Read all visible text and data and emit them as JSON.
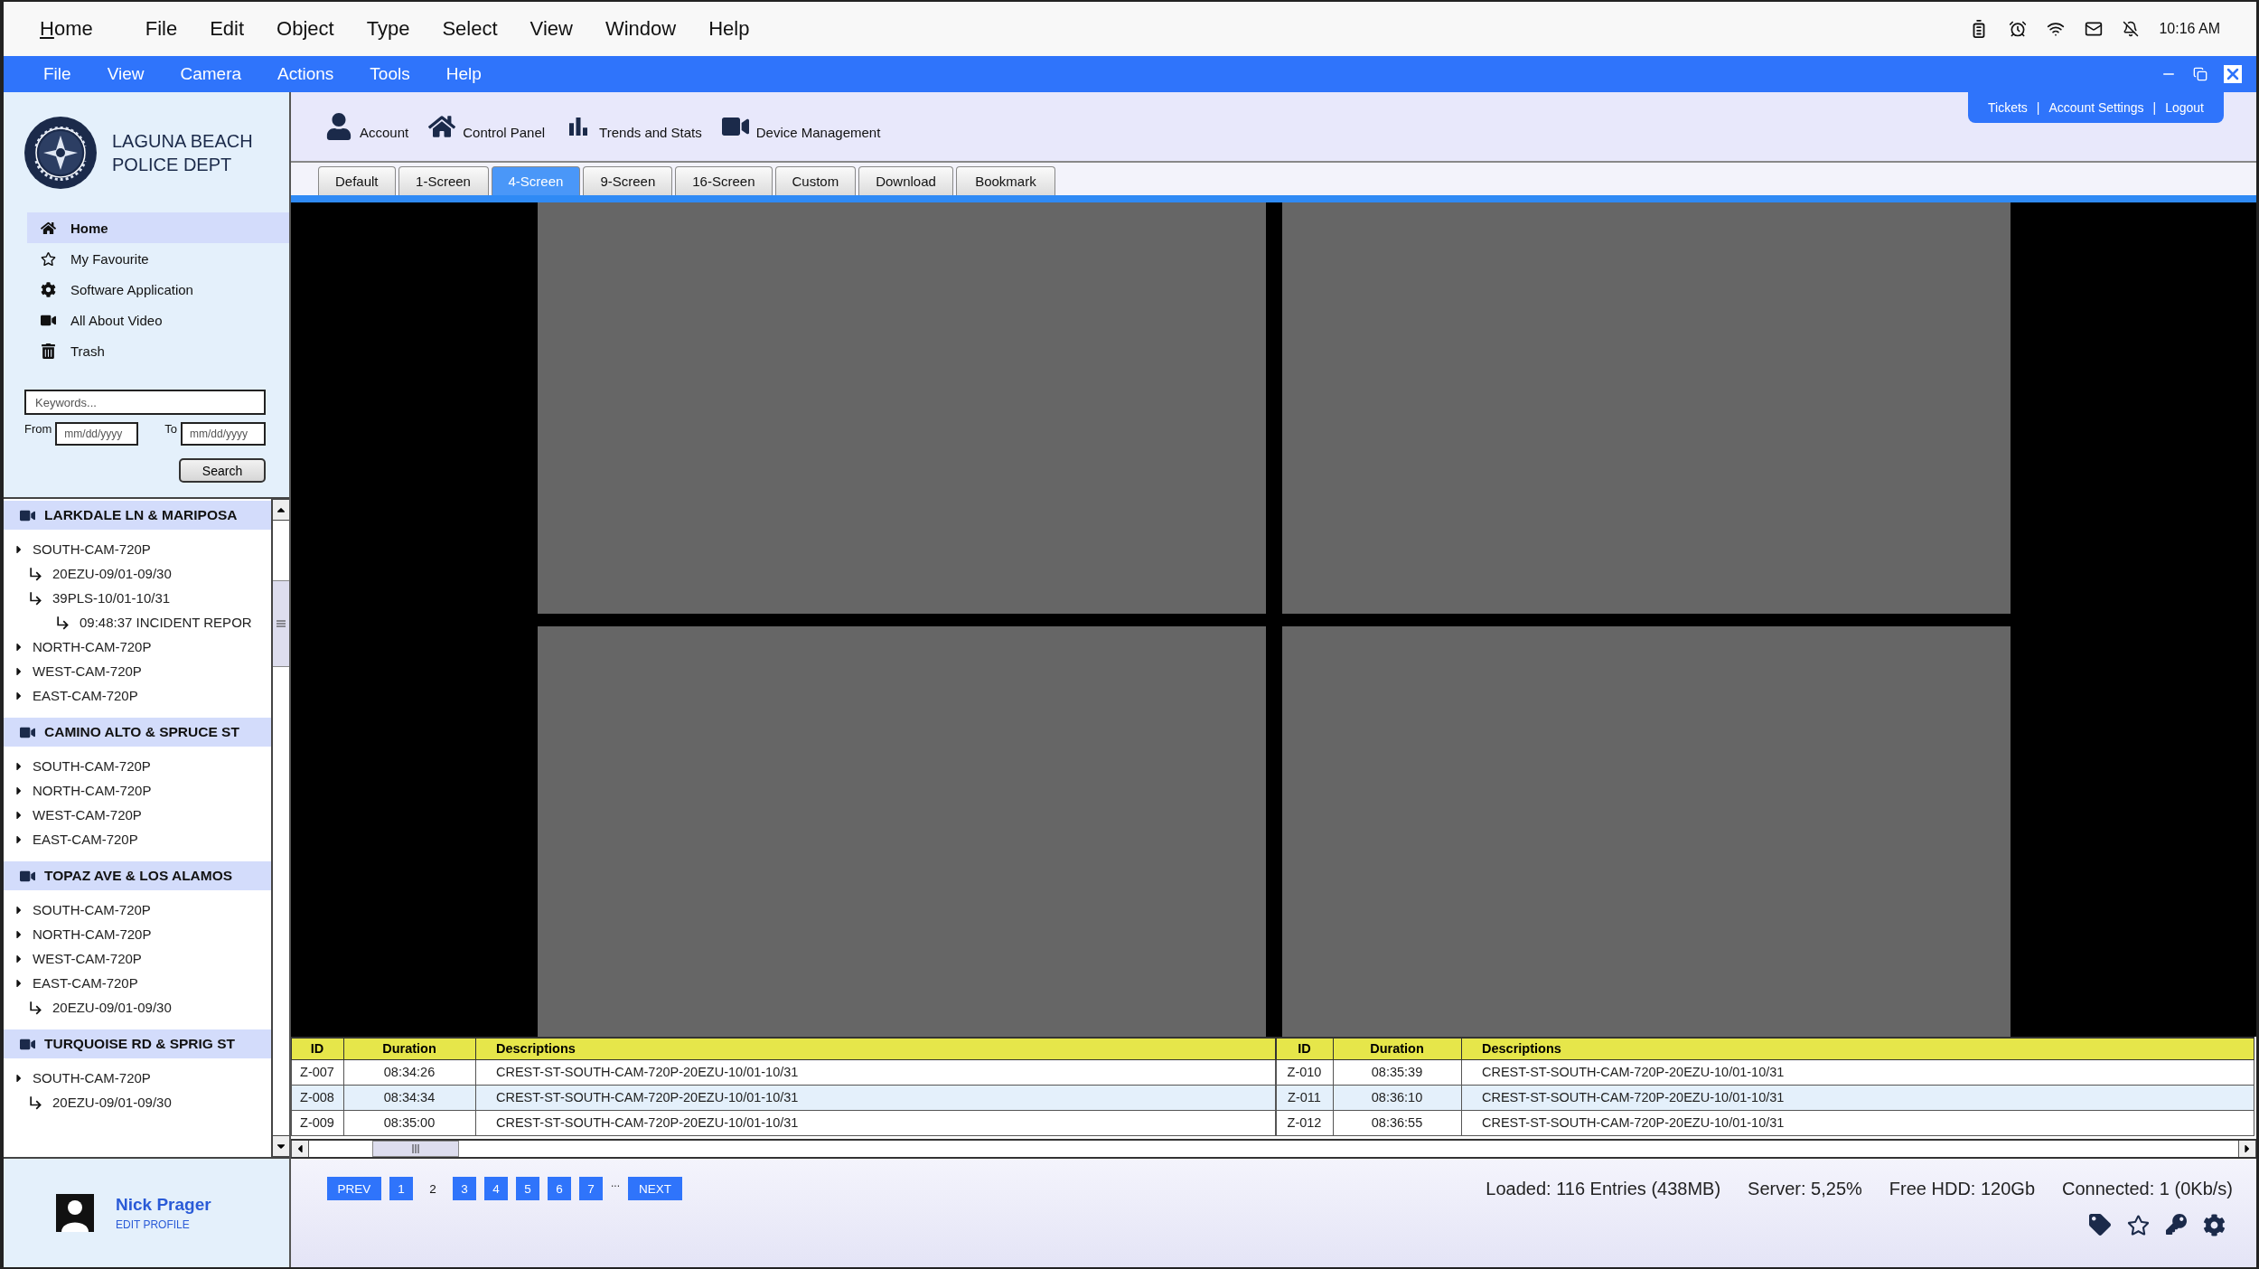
{
  "os_menu": {
    "items": [
      {
        "label": "Home",
        "mnemonic": true
      },
      {
        "label": "File",
        "mnemonic": false
      },
      {
        "label": "Edit",
        "mnemonic": false
      },
      {
        "label": "Object",
        "mnemonic": false
      },
      {
        "label": "Type",
        "mnemonic": false
      },
      {
        "label": "Select",
        "mnemonic": false
      },
      {
        "label": "View",
        "mnemonic": false
      },
      {
        "label": "Window",
        "mnemonic": false
      },
      {
        "label": "Help",
        "mnemonic": false
      }
    ],
    "time": "10:16 AM"
  },
  "app_menu": {
    "items": [
      "File",
      "View",
      "Camera",
      "Actions",
      "Tools",
      "Help"
    ]
  },
  "sidebar": {
    "org_name": "LAGUNA BEACH POLICE DEPT",
    "nav": [
      {
        "label": "Home",
        "selected": true
      },
      {
        "label": "My Favourite",
        "selected": false
      },
      {
        "label": "Software Application",
        "selected": false
      },
      {
        "label": "All About Video",
        "selected": false
      },
      {
        "label": "Trash",
        "selected": false
      }
    ],
    "search": {
      "keywords_placeholder": "Keywords...",
      "from_label": "From",
      "from_placeholder": "mm/dd/yyyy",
      "to_label": "To",
      "to_placeholder": "mm/dd/yyyy",
      "button": "Search"
    },
    "tree": [
      {
        "label": "LARKDALE LN & MARIPOSA",
        "children": [
          {
            "label": "SOUTH-CAM-720P",
            "children": [
              {
                "label": "20EZU-09/01-09/30"
              },
              {
                "label": "39PLS-10/01-10/31",
                "children": [
                  {
                    "label": "09:48:37 INCIDENT REPOR"
                  }
                ]
              }
            ]
          },
          {
            "label": "NORTH-CAM-720P"
          },
          {
            "label": "WEST-CAM-720P"
          },
          {
            "label": "EAST-CAM-720P"
          }
        ]
      },
      {
        "label": "CAMINO ALTO & SPRUCE ST",
        "children": [
          {
            "label": "SOUTH-CAM-720P"
          },
          {
            "label": "NORTH-CAM-720P"
          },
          {
            "label": "WEST-CAM-720P"
          },
          {
            "label": "EAST-CAM-720P"
          }
        ]
      },
      {
        "label": "TOPAZ AVE & LOS ALAMOS",
        "children": [
          {
            "label": "SOUTH-CAM-720P"
          },
          {
            "label": "NORTH-CAM-720P"
          },
          {
            "label": "WEST-CAM-720P"
          },
          {
            "label": "EAST-CAM-720P",
            "children": [
              {
                "label": "20EZU-09/01-09/30"
              }
            ]
          }
        ]
      },
      {
        "label": "TURQUOISE RD & SPRIG ST",
        "children": [
          {
            "label": "SOUTH-CAM-720P",
            "children": [
              {
                "label": "20EZU-09/01-09/30"
              }
            ]
          }
        ]
      }
    ],
    "user": {
      "name": "Nick Prager",
      "link": "EDIT PROFILE"
    }
  },
  "toolbar": [
    {
      "label": "Account"
    },
    {
      "label": "Control Panel"
    },
    {
      "label": "Trends and Stats"
    },
    {
      "label": "Device Management"
    }
  ],
  "top_links": {
    "items": [
      "Tickets",
      "Account Settings",
      "Logout"
    ],
    "separator": "|"
  },
  "tabs": [
    {
      "label": "Default",
      "selected": false
    },
    {
      "label": "1-Screen",
      "selected": false
    },
    {
      "label": "4-Screen",
      "selected": true
    },
    {
      "label": "9-Screen",
      "selected": false
    },
    {
      "label": "16-Screen",
      "selected": false
    },
    {
      "label": "Custom",
      "selected": false
    },
    {
      "label": "Download",
      "selected": false
    },
    {
      "label": "Bookmark",
      "selected": false
    }
  ],
  "tables": [
    {
      "columns": [
        "ID",
        "Duration",
        "Descriptions"
      ],
      "rows": [
        {
          "cells": [
            "Z-007",
            "08:34:26",
            "CREST-ST-SOUTH-CAM-720P-20EZU-10/01-10/31"
          ],
          "selected": false
        },
        {
          "cells": [
            "Z-008",
            "08:34:34",
            "CREST-ST-SOUTH-CAM-720P-20EZU-10/01-10/31"
          ],
          "selected": true
        },
        {
          "cells": [
            "Z-009",
            "08:35:00",
            "CREST-ST-SOUTH-CAM-720P-20EZU-10/01-10/31"
          ],
          "selected": false
        }
      ]
    },
    {
      "columns": [
        "ID",
        "Duration",
        "Descriptions"
      ],
      "rows": [
        {
          "cells": [
            "Z-010",
            "08:35:39",
            "CREST-ST-SOUTH-CAM-720P-20EZU-10/01-10/31"
          ],
          "selected": false
        },
        {
          "cells": [
            "Z-011",
            "08:36:10",
            "CREST-ST-SOUTH-CAM-720P-20EZU-10/01-10/31"
          ],
          "selected": true
        },
        {
          "cells": [
            "Z-012",
            "08:36:55",
            "CREST-ST-SOUTH-CAM-720P-20EZU-10/01-10/31"
          ],
          "selected": false
        }
      ]
    }
  ],
  "pagination": {
    "prev": "PREV",
    "pages": [
      {
        "label": "1",
        "selected": false
      },
      {
        "label": "2",
        "selected": true
      },
      {
        "label": "3",
        "selected": false
      },
      {
        "label": "4",
        "selected": false
      },
      {
        "label": "5",
        "selected": false
      },
      {
        "label": "6",
        "selected": false
      },
      {
        "label": "7",
        "selected": false
      }
    ],
    "ellipsis": "...",
    "next": "NEXT"
  },
  "status": [
    "Loaded: 116 Entries (438MB)",
    "Server: 5,25%",
    "Free HDD: 120Gb",
    "Connected: 1 (0Kb/s)"
  ]
}
